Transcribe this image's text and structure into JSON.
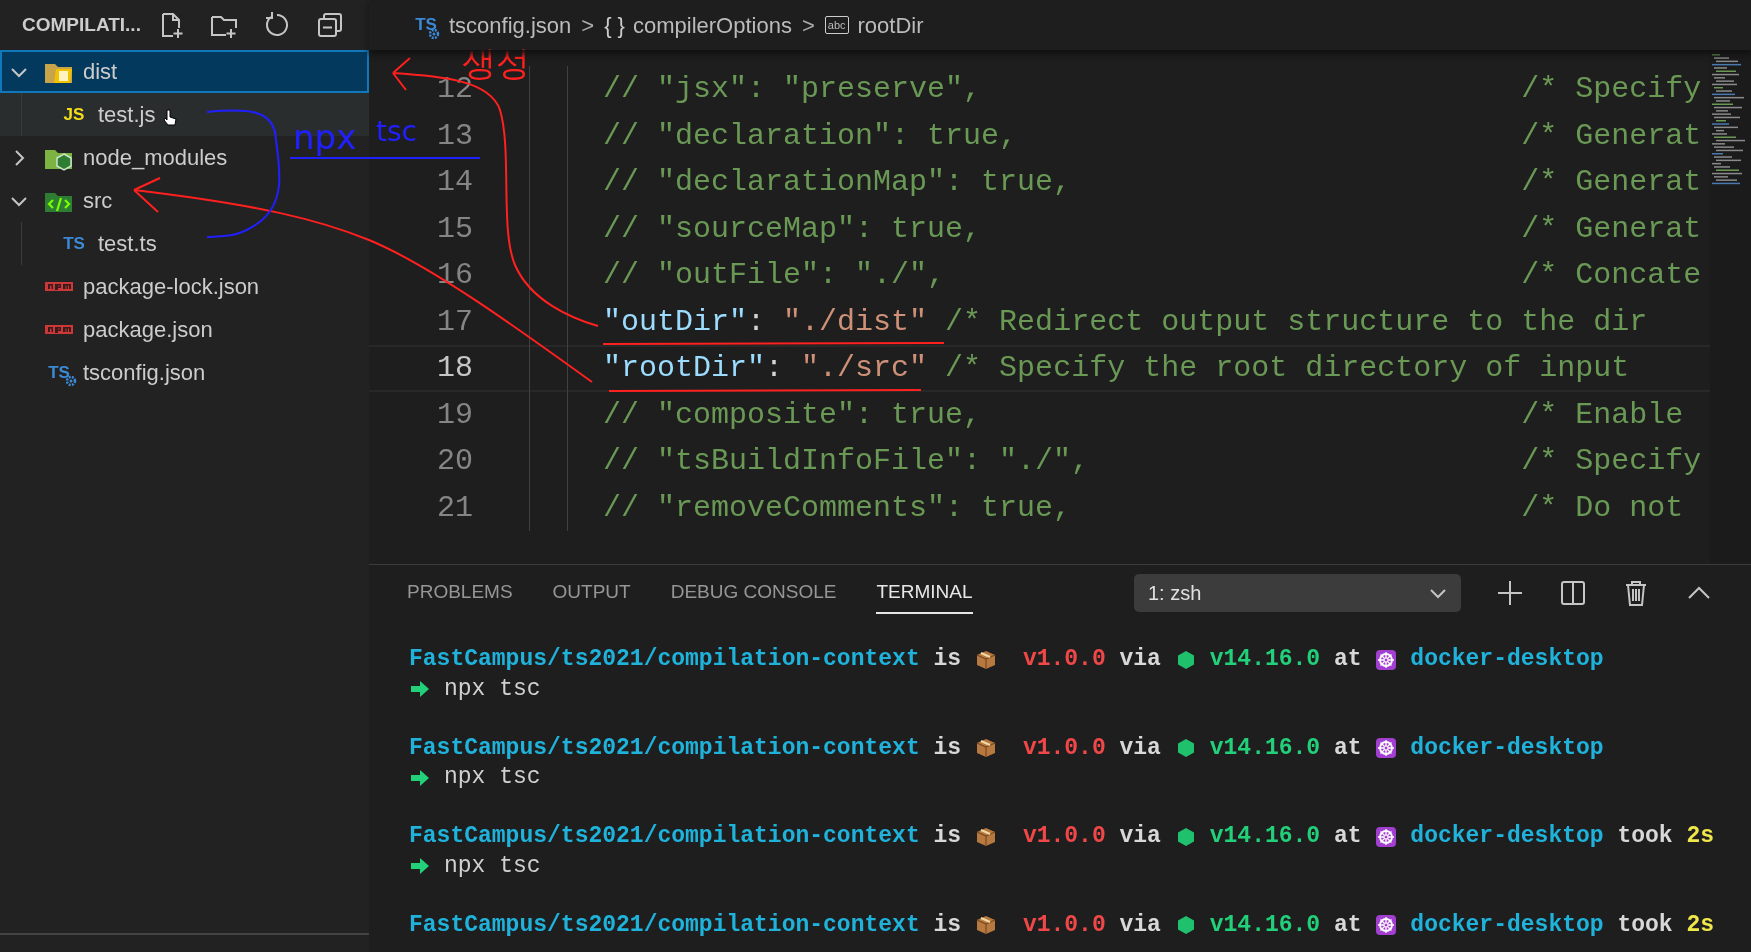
{
  "explorer": {
    "title": "COMPILATI...",
    "tree": [
      {
        "label": "dist",
        "kind": "output",
        "expanded": true,
        "selected": true,
        "hovered": false,
        "children": [
          {
            "label": "test.js",
            "kind": "js",
            "badge": "JS",
            "selected": false,
            "hovered": true
          }
        ]
      },
      {
        "label": "node_modules",
        "kind": "modules",
        "expanded": false,
        "selected": false,
        "hovered": false
      },
      {
        "label": "src",
        "kind": "source",
        "expanded": true,
        "selected": false,
        "hovered": false,
        "children": [
          {
            "label": "test.ts",
            "kind": "ts",
            "badge": "TS",
            "selected": false,
            "hovered": false
          }
        ]
      },
      {
        "label": "package-lock.json",
        "kind": "npm",
        "selected": false,
        "hovered": false
      },
      {
        "label": "package.json",
        "kind": "npm",
        "selected": false,
        "hovered": false
      },
      {
        "label": "tsconfig.json",
        "kind": "config",
        "badge": "TS",
        "selected": false,
        "hovered": false
      }
    ]
  },
  "breadcrumb": [
    {
      "label": "tsconfig.json",
      "kind": "file",
      "badge": "TS"
    },
    {
      "separator": ">",
      "label": "compilerOptions",
      "kind": "object",
      "symbol": "{ }"
    },
    {
      "separator": ">",
      "label": "rootDir",
      "kind": "string",
      "symbol": "abc"
    }
  ],
  "editor": {
    "lines": [
      {
        "number": "12",
        "kind": "comment",
        "current": false,
        "code": "// \"jsx\": \"preserve\",",
        "note": "/* Specify"
      },
      {
        "number": "13",
        "kind": "comment",
        "current": false,
        "code": "// \"declaration\": true,",
        "note": "/* Generat"
      },
      {
        "number": "14",
        "kind": "comment",
        "current": false,
        "code": "// \"declarationMap\": true,",
        "note": "/* Generat"
      },
      {
        "number": "15",
        "kind": "comment",
        "current": false,
        "code": "// \"sourceMap\": true,",
        "note": "/* Generat"
      },
      {
        "number": "16",
        "kind": "comment",
        "current": false,
        "code": "// \"outFile\": \"./\",",
        "note": "/* Concate"
      },
      {
        "number": "17",
        "kind": "setting",
        "current": false,
        "key": "\"outDir\"",
        "punct": ":",
        "value": "\"./dist\"",
        "note": "/* Redirect output structure to the dir"
      },
      {
        "number": "18",
        "kind": "setting",
        "current": true,
        "key": "\"rootDir\"",
        "punct": ":",
        "value": "\"./src\"",
        "note": "/* Specify the root directory of input"
      },
      {
        "number": "19",
        "kind": "comment",
        "current": false,
        "code": "// \"composite\": true,",
        "note": "/* Enable"
      },
      {
        "number": "20",
        "kind": "comment",
        "current": false,
        "code": "// \"tsBuildInfoFile\": \"./\",",
        "note": "/* Specify"
      },
      {
        "number": "21",
        "kind": "comment",
        "current": false,
        "code": "// \"removeComments\": true,",
        "note": "/* Do not"
      }
    ]
  },
  "panel": {
    "tabs": [
      {
        "label": "PROBLEMS",
        "selected": false
      },
      {
        "label": "OUTPUT",
        "selected": false
      },
      {
        "label": "DEBUG CONSOLE",
        "selected": false
      },
      {
        "label": "TERMINAL",
        "selected": true
      }
    ],
    "shell": "1: zsh",
    "entries": [
      {
        "path": "FastCampus/ts2021/compilation-context",
        "is": "is",
        "version": "v1.0.0",
        "via": "via",
        "node": "v14.16.0",
        "at": "at",
        "context": "docker-desktop",
        "command": "npx tsc"
      },
      {
        "path": "FastCampus/ts2021/compilation-context",
        "is": "is",
        "version": "v1.0.0",
        "via": "via",
        "node": "v14.16.0",
        "at": "at",
        "context": "docker-desktop",
        "command": "npx tsc"
      },
      {
        "path": "FastCampus/ts2021/compilation-context",
        "is": "is",
        "version": "v1.0.0",
        "via": "via",
        "node": "v14.16.0",
        "at": "at",
        "context": "docker-desktop",
        "took": "took",
        "duration": "2s",
        "command": "npx tsc"
      },
      {
        "path": "FastCampus/ts2021/compilation-context",
        "is": "is",
        "version": "v1.0.0",
        "via": "via",
        "node": "v14.16.0",
        "at": "at",
        "context": "docker-desktop",
        "took": "took",
        "duration": "2s"
      }
    ]
  },
  "annotations": [
    {
      "text": "생성",
      "color": "#ff2020"
    },
    {
      "text": "npx",
      "color": "#2020ff"
    },
    {
      "text": "tsc",
      "color": "#2020ff"
    }
  ]
}
